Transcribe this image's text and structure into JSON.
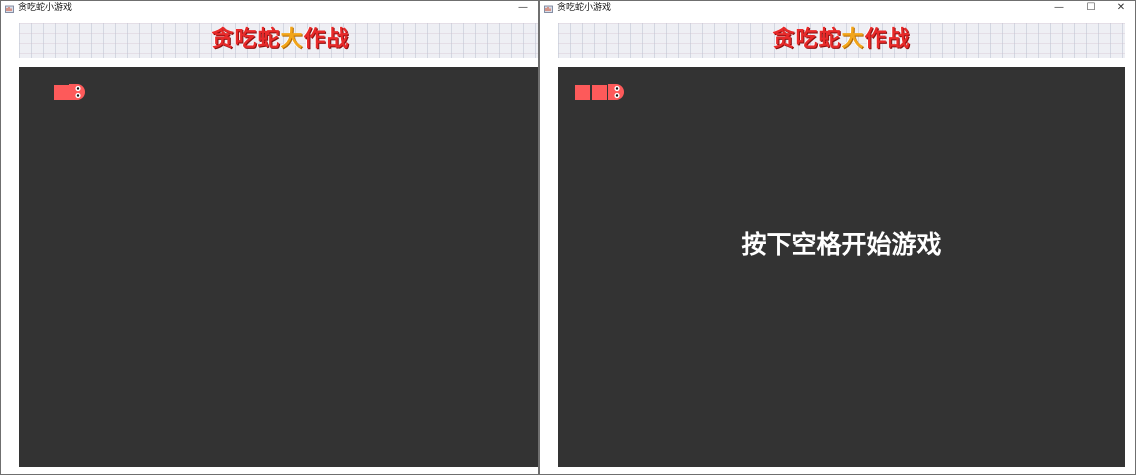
{
  "windows": {
    "left": {
      "title": "贪吃蛇小游戏",
      "controls": {
        "minimize": "—"
      },
      "banner": {
        "title_red": "贪吃蛇",
        "title_gold": "大",
        "title_red2": "作战"
      },
      "prompt": ""
    },
    "right": {
      "title": "贪吃蛇小游戏",
      "controls": {
        "minimize": "—",
        "maximize": "☐",
        "close": "✕"
      },
      "banner": {
        "title_red": "贪吃蛇",
        "title_gold": "大",
        "title_red2": "作战"
      },
      "prompt": "按下空格开始游戏"
    }
  },
  "colors": {
    "board": "#333333",
    "snake": "#fd5a5a",
    "banner_red": "#e82a2a",
    "banner_gold": "#f2a51a"
  },
  "icons": {
    "app": "java-app-icon",
    "snake_head": "snake-head-icon"
  }
}
